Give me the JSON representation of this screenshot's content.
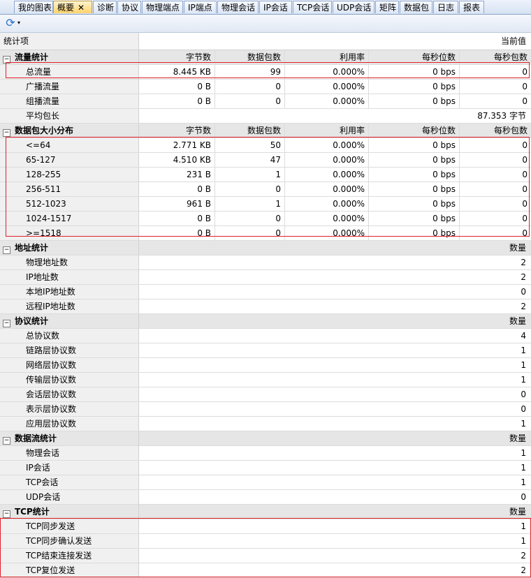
{
  "tabs": [
    "我的图表",
    "概要",
    "诊断",
    "协议",
    "物理端点",
    "IP端点",
    "物理会话",
    "IP会话",
    "TCP会话",
    "UDP会话",
    "矩阵",
    "数据包",
    "日志",
    "报表"
  ],
  "active_tab_close": "✕",
  "toolbar": {
    "refresh_icon": "refresh-icon",
    "dropdown_glyph": "▾"
  },
  "header": {
    "col_item": "统计项",
    "col_value": "当前值"
  },
  "traffic": {
    "title": "流量统计",
    "columns": [
      "字节数",
      "数据包数",
      "利用率",
      "每秒位数",
      "每秒包数"
    ],
    "rows": [
      {
        "name": "总流量",
        "values": [
          "8.445 KB",
          "99",
          "0.000%",
          "0 bps",
          "0"
        ]
      },
      {
        "name": "广播流量",
        "values": [
          "0  B",
          "0",
          "0.000%",
          "0 bps",
          "0"
        ]
      },
      {
        "name": "组播流量",
        "values": [
          "0  B",
          "0",
          "0.000%",
          "0 bps",
          "0"
        ]
      }
    ],
    "avg_label": "平均包长",
    "avg_value": "87.353 字节"
  },
  "size_dist": {
    "title": "数据包大小分布",
    "columns": [
      "字节数",
      "数据包数",
      "利用率",
      "每秒位数",
      "每秒包数"
    ],
    "rows": [
      {
        "name": "<=64",
        "values": [
          "2.771 KB",
          "50",
          "0.000%",
          "0 bps",
          "0"
        ]
      },
      {
        "name": "65-127",
        "values": [
          "4.510 KB",
          "47",
          "0.000%",
          "0 bps",
          "0"
        ]
      },
      {
        "name": "128-255",
        "values": [
          "231  B",
          "1",
          "0.000%",
          "0 bps",
          "0"
        ]
      },
      {
        "name": "256-511",
        "values": [
          "0  B",
          "0",
          "0.000%",
          "0 bps",
          "0"
        ]
      },
      {
        "name": "512-1023",
        "values": [
          "961  B",
          "1",
          "0.000%",
          "0 bps",
          "0"
        ]
      },
      {
        "name": "1024-1517",
        "values": [
          "0  B",
          "0",
          "0.000%",
          "0 bps",
          "0"
        ]
      },
      {
        "name": ">=1518",
        "values": [
          "0  B",
          "0",
          "0.000%",
          "0 bps",
          "0"
        ]
      }
    ]
  },
  "address": {
    "title": "地址统计",
    "col": "数量",
    "rows": [
      {
        "name": "物理地址数",
        "value": "2"
      },
      {
        "name": "IP地址数",
        "value": "2"
      },
      {
        "name": "本地IP地址数",
        "value": "0"
      },
      {
        "name": "远程IP地址数",
        "value": "2"
      }
    ]
  },
  "protocol": {
    "title": "协议统计",
    "col": "数量",
    "rows": [
      {
        "name": "总协议数",
        "value": "4"
      },
      {
        "name": "链路层协议数",
        "value": "1"
      },
      {
        "name": "网络层协议数",
        "value": "1"
      },
      {
        "name": "传输层协议数",
        "value": "1"
      },
      {
        "name": "会话层协议数",
        "value": "0"
      },
      {
        "name": "表示层协议数",
        "value": "0"
      },
      {
        "name": "应用层协议数",
        "value": "1"
      }
    ]
  },
  "flow": {
    "title": "数据流统计",
    "col": "数量",
    "rows": [
      {
        "name": "物理会话",
        "value": "1"
      },
      {
        "name": "IP会话",
        "value": "1"
      },
      {
        "name": "TCP会话",
        "value": "1"
      },
      {
        "name": "UDP会话",
        "value": "0"
      }
    ]
  },
  "tcp": {
    "title": "TCP统计",
    "col": "数量",
    "rows": [
      {
        "name": "TCP同步发送",
        "value": "1"
      },
      {
        "name": "TCP同步确认发送",
        "value": "1"
      },
      {
        "name": "TCP结束连接发送",
        "value": "2"
      },
      {
        "name": "TCP复位发送",
        "value": "2"
      }
    ]
  },
  "highlight_color": "#e0202a"
}
